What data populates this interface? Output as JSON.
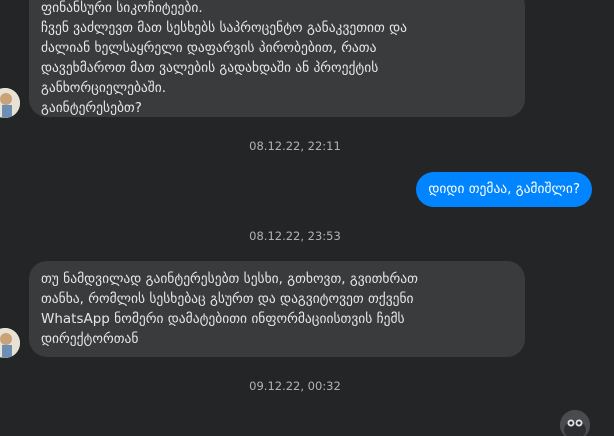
{
  "messages": [
    {
      "direction": "incoming",
      "text": "ფინანსური სიკოჩიტეები.\n   ჩვენ ვაძლევთ მათ სესხებს საპროცენტო განაკვეთით და\nძალიან ხელსაყრელი დაფარვის პირობებით, რათა\nდავეხმაროთ მათ ვალების გადახდაში ან პროექტის\nგანხორციელებაში.\n   გაინტერესებთ?"
    },
    {
      "direction": "timestamp",
      "text": "08.12.22, 22:11"
    },
    {
      "direction": "outgoing",
      "text": "დიდი თემაა, გამიშლი?"
    },
    {
      "direction": "timestamp",
      "text": "08.12.22, 23:53"
    },
    {
      "direction": "incoming",
      "text": "თუ ნამდვილად გაინტერესებთ სესხი, გთხოვთ, გვითხრათ\nთანხა, რომლის სესხებაც გსურთ და დაგვიტოვეთ თქვენი\nWhatsApp ნომერი დამატებითი ინფორმაციისთვის ჩემს\nდირექტორთან"
    },
    {
      "direction": "timestamp",
      "text": "09.12.22, 00:32"
    }
  ],
  "colors": {
    "background": "#242526",
    "incoming_bubble": "#3a3b3c",
    "outgoing_bubble": "#0084ff",
    "text": "#e4e6eb",
    "timestamp": "#b0b3b8"
  },
  "icons": {
    "sender_avatar": "person-photo-avatar",
    "seen_indicator": "seen-avatar-icon"
  }
}
